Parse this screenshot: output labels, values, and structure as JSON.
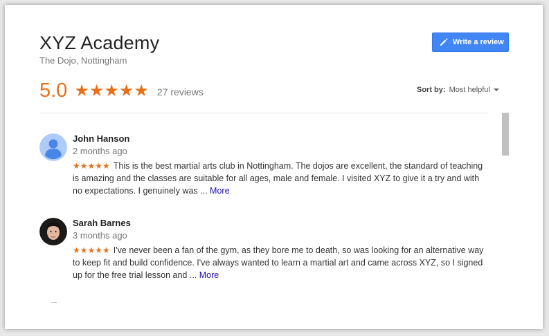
{
  "place": {
    "name": "XYZ Academy",
    "address": "The Dojo, Nottingham"
  },
  "actions": {
    "write_review_label": "Write a review"
  },
  "summary": {
    "rating": "5.0",
    "stars": "★★★★★",
    "review_count": "27 reviews"
  },
  "sort": {
    "label": "Sort by:",
    "value": "Most helpful"
  },
  "reviews": [
    {
      "name": "John Hanson",
      "time": "2 months ago",
      "stars": "★★★★★",
      "text": "This is the best martial arts club in Nottingham. The dojos are excellent, the standard of teaching is amazing and the classes are suitable for all ages, male and female.  I visited XYZ to give it a try and with no expectations. I genuinely was ...",
      "more": "More"
    },
    {
      "name": "Sarah Barnes",
      "time": "3 months ago",
      "stars": "★★★★★",
      "text": "I've never been a fan of the gym, as they bore me to death, so was looking for an alternative way to keep fit and build confidence. I've always wanted to learn a martial art and came across XYZ, so I signed up for the free trial lesson and ...",
      "more": "More"
    }
  ],
  "colors": {
    "accent_orange": "#e7711b",
    "button_blue": "#4285f4",
    "link_blue": "#1a0dab"
  }
}
